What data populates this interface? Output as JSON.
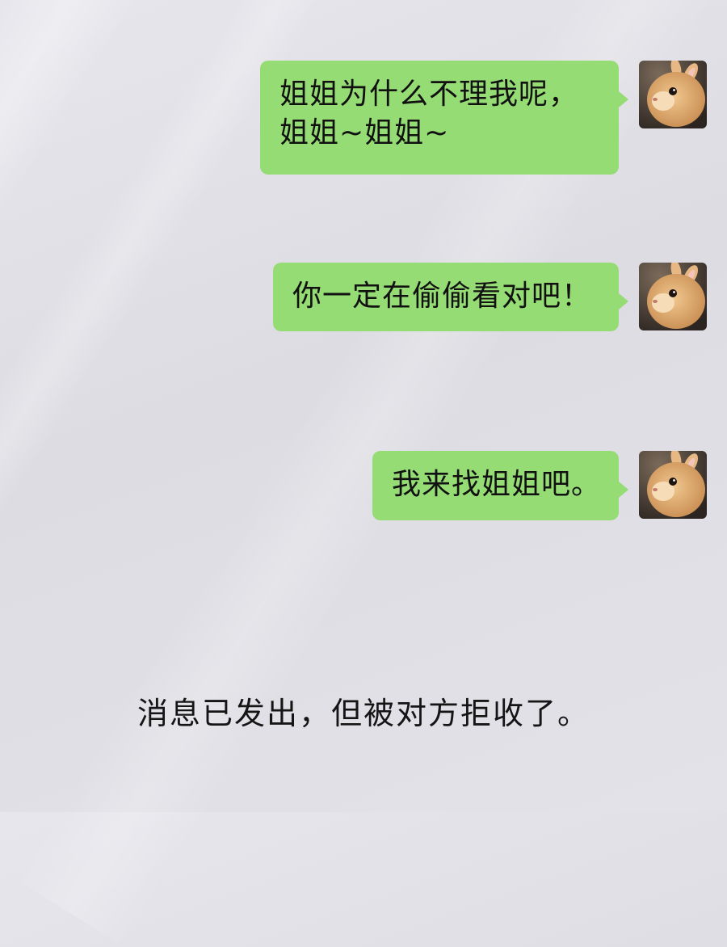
{
  "messages": [
    {
      "sender": "self",
      "text": "姐姐为什么不理我呢，\n姐姐~姐姐~",
      "avatar_icon": "rabbit-avatar-icon"
    },
    {
      "sender": "self",
      "text": "你一定在偷偷看对吧！",
      "avatar_icon": "rabbit-avatar-icon"
    },
    {
      "sender": "self",
      "text": "我来找姐姐吧。",
      "avatar_icon": "rabbit-avatar-icon"
    }
  ],
  "system_note": "消息已发出，但被对方拒收了。",
  "colors": {
    "bubble_background": "#95dc74",
    "page_background": "#e2e2e8",
    "text": "#111111"
  }
}
